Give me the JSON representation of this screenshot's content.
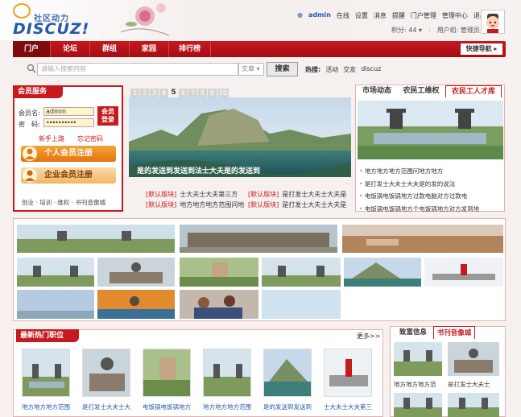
{
  "header": {
    "logo_cn": "社区动力",
    "logo_en": "DISCUZ!",
    "user": "admin",
    "status": "在线",
    "links": [
      "设置",
      "消息",
      "提醒",
      "门户管理",
      "管理中心",
      "退出"
    ],
    "points_label": "积分: 44",
    "points_caret": "▾",
    "group_label": "用户组: 管理员"
  },
  "nav": {
    "items": [
      "门户",
      "论坛",
      "群组",
      "家园",
      "排行榜"
    ],
    "quick": "快捷导航"
  },
  "search": {
    "placeholder": "请输入搜索内容",
    "type": "文章",
    "button": "搜索",
    "hot_label": "热搜:",
    "hot_items": [
      "活动",
      "交友",
      "discuz"
    ]
  },
  "member": {
    "title": "会员服务",
    "user_label": "会员名",
    "user_value": "admin",
    "pass_label": "密　码",
    "pass_value": "••••••••••",
    "login": "会员登录",
    "newbie": "新手上路",
    "forgot": "忘记密码",
    "personal_reg": "个人会员注册",
    "company_reg": "企业会员注册",
    "footer": "创业 · 培训 · 维权 · 书刊音像城"
  },
  "slideshow": {
    "pages": [
      "1",
      "2",
      "3",
      "4",
      "5",
      "6",
      "7",
      "8",
      "9",
      "10"
    ],
    "current": "5",
    "caption": "是的发送到发送到法士大夫是的发送到"
  },
  "news": [
    {
      "tag": "[默认版块]",
      "text": "士大夫士大夫第三方"
    },
    {
      "tag": "[默认版块]",
      "text": "是打发士大夫士大夫是"
    },
    {
      "tag": "[默认版块]",
      "text": "地方地方地方范围问地"
    },
    {
      "tag": "[默认版块]",
      "text": "是打发士大夫士大夫是"
    }
  ],
  "right_tabs": {
    "tabs": [
      "市场动态",
      "农民工维权",
      "农民工人才库"
    ],
    "list": [
      "地方地方地方范围问地方地方",
      "是打发士大夫士大夫是的发的说法",
      "电饭锅电饭锅地方过款电脑对方过款电",
      "电饭锅电饭锅地方个电饭锅地方对方发到地"
    ]
  },
  "jobs": {
    "title": "最新热门职位",
    "more": "更多>>",
    "items": [
      "地方地方地方范围",
      "是打发士大夫士大",
      "电饭锅电饭锅地方",
      "地方地方地方范围",
      "是的发送到发送到",
      "士大夫士大夫第三"
    ]
  },
  "side": {
    "tabs": [
      "致富信息",
      "书刊音像城"
    ],
    "captions": [
      "地方地方地方范",
      "是打发士大夫士"
    ]
  }
}
